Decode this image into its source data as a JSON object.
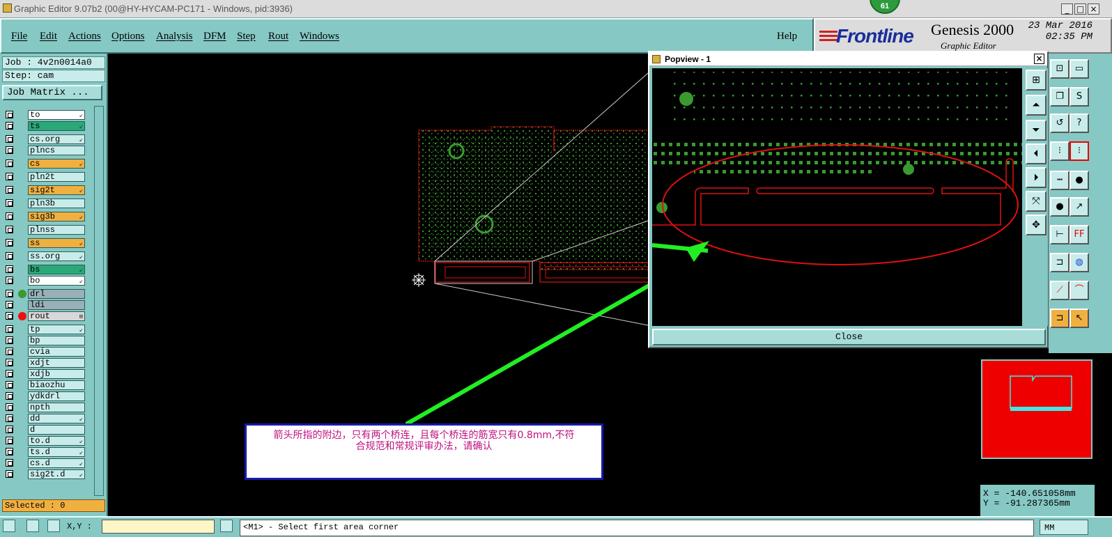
{
  "window": {
    "title": "Graphic Editor 9.07b2 (00@HY-HYCAM-PC171 - Windows, pid:3936)",
    "minimize": "_",
    "maximize": "□",
    "close": "×",
    "badge": "61"
  },
  "menu": {
    "items": [
      "File",
      "Edit",
      "Actions",
      "Options",
      "Analysis",
      "DFM",
      "Step",
      "Rout",
      "Windows"
    ],
    "help": "Help"
  },
  "brand": {
    "logo": "Frontline",
    "product": "Genesis 2000",
    "subtitle": "Graphic Editor",
    "date": "23 Mar 2016",
    "time": "02:35 PM"
  },
  "job": {
    "job": "Job : 4v2n0014a0",
    "step": "Step: cam",
    "matrix_button": "Job Matrix ..."
  },
  "layers": [
    {
      "name": "to",
      "bg": "#ffffff",
      "dot": "",
      "mark": "↙"
    },
    {
      "name": "ts",
      "bg": "#2aa878",
      "dot": "",
      "mark": "↙"
    },
    {
      "name": "cs.org",
      "bg": "#c8ecea",
      "dot": "",
      "mark": "↙"
    },
    {
      "name": "plncs",
      "bg": "#c8ecea",
      "dot": "",
      "mark": ""
    },
    {
      "name": "cs",
      "bg": "#f0b040",
      "dot": "",
      "mark": "↙"
    },
    {
      "name": "pln2t",
      "bg": "#c8ecea",
      "dot": "",
      "mark": ""
    },
    {
      "name": "sig2t",
      "bg": "#f0b040",
      "dot": "",
      "mark": "↙"
    },
    {
      "name": "pln3b",
      "bg": "#c8ecea",
      "dot": "",
      "mark": ""
    },
    {
      "name": "sig3b",
      "bg": "#f0b040",
      "dot": "",
      "mark": "↙"
    },
    {
      "name": "plnss",
      "bg": "#c8ecea",
      "dot": "",
      "mark": ""
    },
    {
      "name": "ss",
      "bg": "#f0b040",
      "dot": "",
      "mark": "↙"
    },
    {
      "name": "ss.org",
      "bg": "#c8ecea",
      "dot": "",
      "mark": "↙"
    },
    {
      "name": "bs",
      "bg": "#2aa878",
      "dot": "",
      "mark": "↙"
    },
    {
      "name": "bo",
      "bg": "#ffffff",
      "dot": "",
      "mark": "↙"
    },
    {
      "name": "drl",
      "bg": "#9ab0b8",
      "dot": "#3a9a30",
      "mark": ""
    },
    {
      "name": "ldi",
      "bg": "#9ab0b8",
      "dot": "",
      "mark": ""
    },
    {
      "name": "rout",
      "bg": "#d8d8d8",
      "dot": "#ee1010",
      "mark": "⊞"
    },
    {
      "name": "tp",
      "bg": "#c8ecea",
      "dot": "",
      "mark": "↙"
    },
    {
      "name": "bp",
      "bg": "#c8ecea",
      "dot": "",
      "mark": ""
    },
    {
      "name": "cvia",
      "bg": "#c8ecea",
      "dot": "",
      "mark": ""
    },
    {
      "name": "xdjt",
      "bg": "#c8ecea",
      "dot": "",
      "mark": ""
    },
    {
      "name": "xdjb",
      "bg": "#c8ecea",
      "dot": "",
      "mark": ""
    },
    {
      "name": "biaozhu",
      "bg": "#c8ecea",
      "dot": "",
      "mark": ""
    },
    {
      "name": "ydkdrl",
      "bg": "#c8ecea",
      "dot": "",
      "mark": ""
    },
    {
      "name": "npth",
      "bg": "#c8ecea",
      "dot": "",
      "mark": ""
    },
    {
      "name": "dd",
      "bg": "#c8ecea",
      "dot": "",
      "mark": "↙"
    },
    {
      "name": "d",
      "bg": "#c8ecea",
      "dot": "",
      "mark": ""
    },
    {
      "name": "to.d",
      "bg": "#c8ecea",
      "dot": "",
      "mark": "↙"
    },
    {
      "name": "ts.d",
      "bg": "#c8ecea",
      "dot": "",
      "mark": "↙"
    },
    {
      "name": "cs.d",
      "bg": "#c8ecea",
      "dot": "",
      "mark": "↙"
    },
    {
      "name": "sig2t.d",
      "bg": "#c8ecea",
      "dot": "",
      "mark": "↙"
    }
  ],
  "selected": "Selected : 0",
  "popview": {
    "title": "Popview - 1",
    "close": "Close"
  },
  "annotation": {
    "line1": "箭头所指的附边，只有两个桥连，且每个桥连的筋宽只有0.8mm,不符",
    "line2": "合规范和常规评审办法，请确认"
  },
  "coords": {
    "x": "X = -140.651058mm",
    "y": "Y = -91.287365mm"
  },
  "bottom": {
    "xy_label": "X,Y :",
    "status": "<M1> - Select first area corner",
    "units": "MM"
  },
  "colors": {
    "panel": "#86c8c4",
    "copper": "#3a9a30",
    "rout": "#e01010",
    "arrow": "#22ee22"
  }
}
